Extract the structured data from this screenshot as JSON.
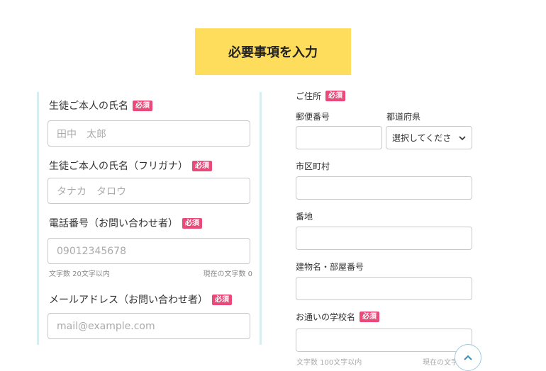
{
  "header": {
    "title": "必要事項を入力"
  },
  "required_badge": "必須",
  "left": {
    "student_name": {
      "label": "生徒ご本人の氏名",
      "placeholder": "田中　太郎"
    },
    "student_name_kana": {
      "label": "生徒ご本人の氏名（フリガナ）",
      "placeholder": "タナカ　タロウ"
    },
    "phone": {
      "label": "電話番号（お問い合わせ者）",
      "placeholder": "09012345678",
      "hint_limit": "文字数 20文字以内",
      "hint_count": "現在の文字数 0"
    },
    "email": {
      "label": "メールアドレス（お問い合わせ者）",
      "placeholder": "mail@example.com"
    }
  },
  "right": {
    "address_label": "ご住所",
    "postal_label": "郵便番号",
    "prefecture_label": "都道府県",
    "prefecture_select": "選択してくださ",
    "city_label": "市区町村",
    "street_label": "番地",
    "building_label": "建物名・部屋番号",
    "school_label": "お通いの学校名",
    "school_hint_partial": "文字数 100文字以内",
    "school_count_partial": "現在の文字数"
  },
  "icons": {
    "scroll_top": "chevron-up-icon",
    "select_arrow": "chevron-down-icon"
  },
  "colors": {
    "title_bg": "#fedd5d",
    "required_badge": "#e94a7a",
    "panel_border": "#d7eef0"
  }
}
